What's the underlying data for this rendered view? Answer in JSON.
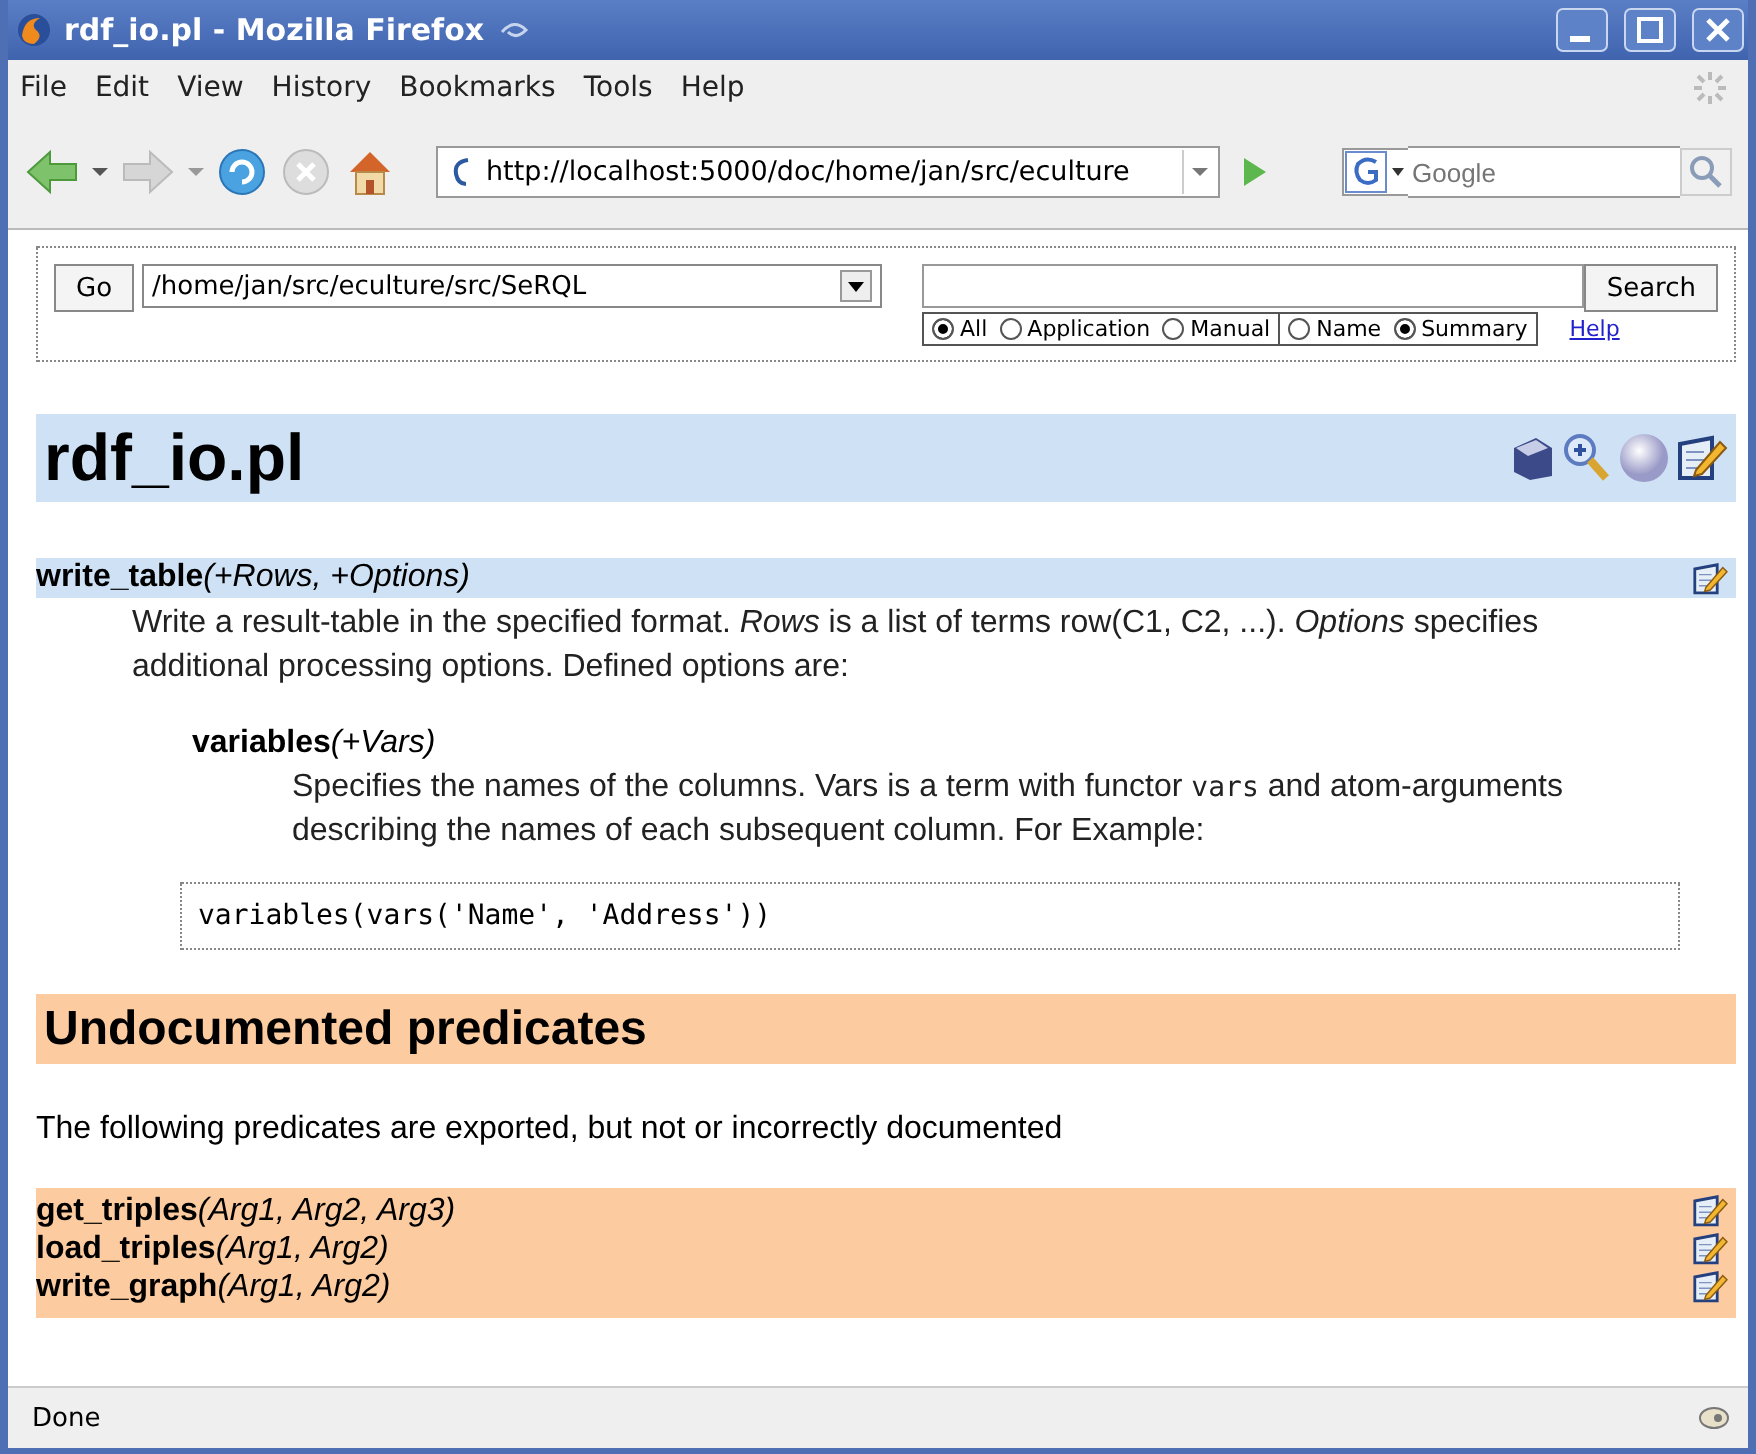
{
  "window": {
    "title": "rdf_io.pl - Mozilla Firefox"
  },
  "menu": [
    {
      "label": "File"
    },
    {
      "label": "Edit"
    },
    {
      "label": "View"
    },
    {
      "label": "History"
    },
    {
      "label": "Bookmarks"
    },
    {
      "label": "Tools"
    },
    {
      "label": "Help"
    }
  ],
  "toolbar": {
    "url": "http://localhost:5000/doc/home/jan/src/eculture",
    "search_placeholder": "Google"
  },
  "search_form": {
    "go_button": "Go",
    "path": "/home/jan/src/eculture/src/SeRQL",
    "search_button": "Search",
    "scope_options": [
      {
        "label": "All",
        "selected": true
      },
      {
        "label": "Application",
        "selected": false
      },
      {
        "label": "Manual",
        "selected": false
      }
    ],
    "field_options": [
      {
        "label": "Name",
        "selected": false
      },
      {
        "label": "Summary",
        "selected": true
      }
    ],
    "help_link": "Help"
  },
  "page": {
    "title": "rdf_io.pl",
    "predicate": {
      "name": "write_table",
      "args": "(+Rows, +Options)",
      "description": "Write a result-table in the specified format. *Rows* is a list of terms row(C1, C2, ...). *Options* specifies additional processing options. Defined options are:",
      "option": {
        "name": "variables",
        "args": "(+Vars)",
        "description": [
          {
            "kind": "text",
            "text": "Specifies the names of the columns. Vars is a term with functor "
          },
          {
            "kind": "code",
            "text": "vars"
          },
          {
            "kind": "text",
            "text": " and atom-arguments describing the names of each subsequent column. For Example:"
          }
        ],
        "code": "variables(vars('Name', 'Address'))"
      }
    },
    "undocumented": {
      "heading": "Undocumented predicates",
      "text": "The following predicates are exported, but not or incorrectly documented",
      "predicates": [
        {
          "name": "get_triples",
          "args": "(Arg1, Arg2, Arg3)"
        },
        {
          "name": "load_triples",
          "args": "(Arg1, Arg2)"
        },
        {
          "name": "write_graph",
          "args": "(Arg1, Arg2)"
        }
      ]
    }
  },
  "status_bar": {
    "text": "Done"
  }
}
